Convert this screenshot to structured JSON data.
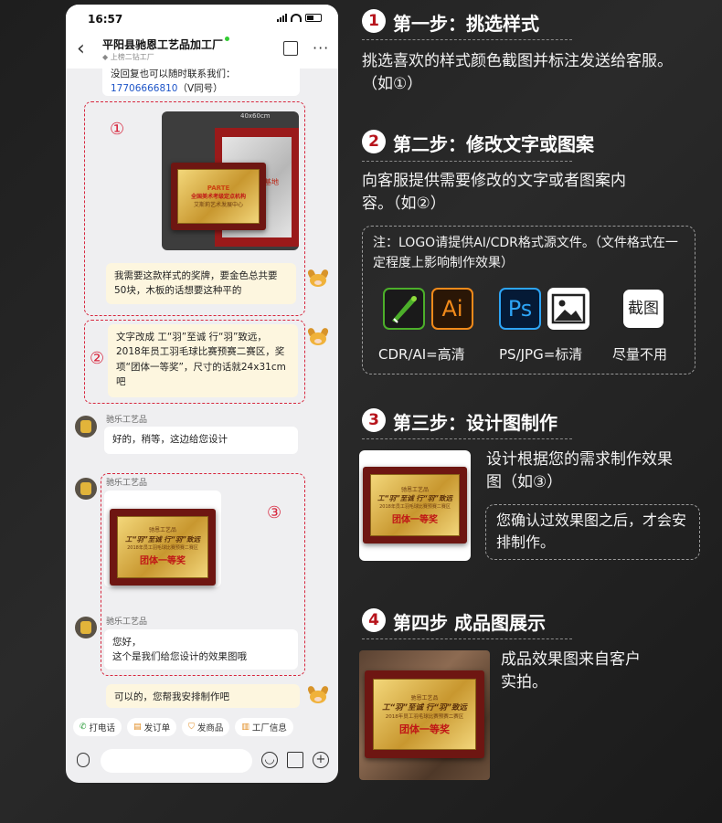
{
  "phone": {
    "status": {
      "time": "16:57"
    },
    "header": {
      "shop_name": "平阳县驰恩工艺品加工厂",
      "sub_tag": "上榜二钻工厂"
    },
    "messages": {
      "top_text_1": "没回复也可以随时联系我们：",
      "top_phone": "17706666810",
      "top_suffix": "（V同号）",
      "img1_overlay": "40x60cm",
      "plaque1": {
        "logo": "PARTE",
        "line1": "全国美术考级定点机构",
        "line2": "艾斯莉艺术发展中心"
      },
      "plaque2": {
        "text": "基地"
      },
      "msg_user_1": "我需要这款样式的奖牌，要金色总共要50块，木板的话想要这种平的",
      "msg_user_2": "文字改成 工“羽”至诚 行“羽”致远，2018年员工羽毛球比赛预赛二赛区，奖项“团体一等奖”，尺寸的话就24x31cm吧",
      "sender_1": "驰乐工艺品",
      "msg_shop_1": "好的，稍等，这边给您设计",
      "sender_2": "驰乐工艺品",
      "design": {
        "org": "驰恩工艺品",
        "slogan": "工“羽”至诚 行“羽”致远",
        "event": "2018年员工羽毛球比赛预赛二赛区",
        "award": "团体一等奖"
      },
      "sender_3": "驰乐工艺品",
      "msg_shop_2a": "您好，",
      "msg_shop_2b": "这个是我们给您设计的效果图哦",
      "msg_user_3": "可以的，您帮我安排制作吧",
      "annot_1": "①",
      "annot_2": "②",
      "annot_3": "③"
    },
    "quick_actions": [
      {
        "icon": "phone-icon",
        "label": "打电话"
      },
      {
        "icon": "order-icon",
        "label": "发订单"
      },
      {
        "icon": "bag-icon",
        "label": "发商品"
      },
      {
        "icon": "factory-icon",
        "label": "工厂信息"
      }
    ]
  },
  "steps": [
    {
      "num": "1",
      "title": "第一步：挑选样式",
      "desc": "挑选喜欢的样式颜色截图并标注发送给客服。（如①）"
    },
    {
      "num": "2",
      "title": "第二步：修改文字或图案",
      "desc": "向客服提供需要修改的文字或者图案内容。（如②）",
      "note": "注：LOGO请提供AI/CDR格式源文件。（文件格式在一定程度上影响制作效果）",
      "icons": [
        {
          "name": "cdr-icon"
        },
        {
          "name": "ai-icon",
          "text": "Ai"
        },
        {
          "name": "ps-icon",
          "text": "Ps"
        },
        {
          "name": "image-icon"
        },
        {
          "name": "screenshot-icon",
          "text": "截图"
        }
      ],
      "labels": [
        "CDR/AI=高清",
        "PS/JPG=标清",
        "尽量不用"
      ]
    },
    {
      "num": "3",
      "title": "第三步：设计图制作",
      "desc": "设计根据您的需求制作效果图（如③）",
      "note": "您确认过效果图之后，才会安排制作。"
    },
    {
      "num": "4",
      "title": "第四步 成品图展示",
      "desc": "成品效果图来自客户实拍。"
    }
  ],
  "colors": {
    "accent_red": "#d7263d",
    "step_red": "#b7141c",
    "bubble_user": "#fdf6df"
  }
}
